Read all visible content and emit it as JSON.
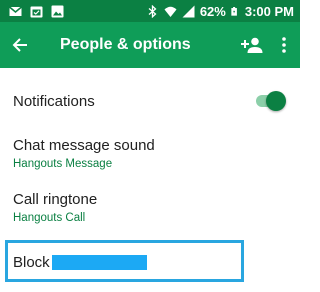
{
  "status_bar": {
    "battery": "62%",
    "time": "3:00 PM",
    "left_icons": [
      "gmail-icon",
      "calendar-icon",
      "photo-icon"
    ],
    "right_icons": [
      "bluetooth-icon",
      "wifi-icon",
      "signal-icon",
      "battery-icon"
    ]
  },
  "app_bar": {
    "title": "People & options",
    "back_icon": "arrow-back-icon",
    "actions": [
      "add-person-icon",
      "more-vert-icon"
    ]
  },
  "settings": {
    "notifications": {
      "label": "Notifications",
      "enabled": true
    },
    "chat_message_sound": {
      "label": "Chat message sound",
      "value": "Hangouts Message"
    },
    "call_ringtone": {
      "label": "Call ringtone",
      "value": "Hangouts Call"
    },
    "block": {
      "label": "Block"
    }
  },
  "colors": {
    "status_bar": "#0b8043",
    "app_bar": "#0f9d58",
    "accent": "#0b8043",
    "highlight_border": "#29a6e0",
    "redaction": "#1ca9f4"
  }
}
